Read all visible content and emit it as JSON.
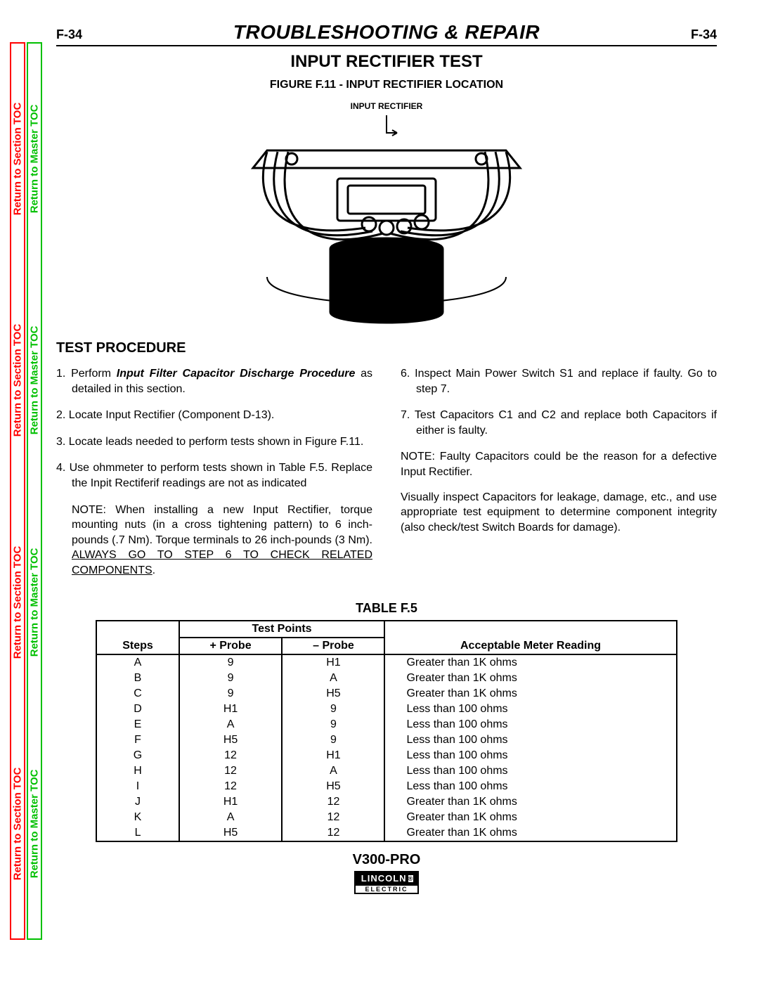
{
  "sidebar": {
    "section_toc_label": "Return to Section TOC",
    "master_toc_label": "Return to Master TOC"
  },
  "header": {
    "page_left": "F-34",
    "page_right": "F-34",
    "main_title": "TROUBLESHOOTING & REPAIR",
    "sub_title": "INPUT RECTIFIER TEST",
    "figure_caption": "FIGURE F.11 - INPUT RECTIFIER LOCATION",
    "figure_inline_label": "INPUT RECTIFIER"
  },
  "procedure": {
    "heading": "TEST PROCEDURE",
    "left": {
      "step1_pre": "1. Perform ",
      "step1_bold": "Input Filter Capacitor Discharge Procedure",
      "step1_post": "  as detailed in this section.",
      "step2": "2. Locate Input Rectifier (Component D-13).",
      "step3": "3. Locate leads needed to perform tests shown in Figure F.11.",
      "step4": "4. Use ohmmeter to perform tests shown in Table F.5. Replace the Inpit Rectiferif readings are not as indicated",
      "note_pre": "NOTE:  When installing a new Input Rectifier, torque mounting nuts (in a cross tightening pattern) to 6 inch-pounds (.7 Nm). Torque terminals to 26 inch-pounds (3 Nm). ",
      "note_underline": "ALWAYS GO TO STEP 6 TO CHECK RELATED COMPONENTS",
      "note_post": "."
    },
    "right": {
      "step6": "6. Inspect Main Power Switch S1 and replace if faulty. Go to step 7.",
      "step7": "7. Test Capacitors C1 and C2 and replace both Capacitors if either is faulty.",
      "note1": "NOTE:  Faulty Capacitors could be the reason for a defective Input Rectifier.",
      "note2": "Visually inspect Capacitors for leakage, damage, etc., and use appropriate test equipment to determine component integrity (also check/test Switch Boards for damage)."
    }
  },
  "table": {
    "title": "TABLE F.5",
    "header_group": "Test Points",
    "col_steps": "Steps",
    "col_plus": "+ Probe",
    "col_minus": "– Probe",
    "col_reading": "Acceptable Meter Reading",
    "rows": [
      {
        "s": "A",
        "p": "9",
        "m": "H1",
        "r": "Greater than 1K ohms"
      },
      {
        "s": "B",
        "p": "9",
        "m": "A",
        "r": "Greater than 1K ohms"
      },
      {
        "s": "C",
        "p": "9",
        "m": "H5",
        "r": "Greater than 1K ohms"
      },
      {
        "s": "D",
        "p": "H1",
        "m": "9",
        "r": "Less than 100 ohms"
      },
      {
        "s": "E",
        "p": "A",
        "m": "9",
        "r": "Less than 100 ohms"
      },
      {
        "s": "F",
        "p": "H5",
        "m": "9",
        "r": "Less than 100 ohms"
      },
      {
        "s": "G",
        "p": "12",
        "m": "H1",
        "r": "Less than 100 ohms"
      },
      {
        "s": "H",
        "p": "12",
        "m": "A",
        "r": "Less than 100 ohms"
      },
      {
        "s": "I",
        "p": "12",
        "m": "H5",
        "r": "Less than 100 ohms"
      },
      {
        "s": "J",
        "p": "H1",
        "m": "12",
        "r": "Greater than 1K ohms"
      },
      {
        "s": "K",
        "p": "A",
        "m": "12",
        "r": "Greater than 1K ohms"
      },
      {
        "s": "L",
        "p": "H5",
        "m": "12",
        "r": "Greater than 1K ohms"
      }
    ]
  },
  "footer": {
    "model": "V300-PRO",
    "logo_top": "LINCOLN",
    "logo_reg": "®",
    "logo_bottom": "ELECTRIC"
  }
}
